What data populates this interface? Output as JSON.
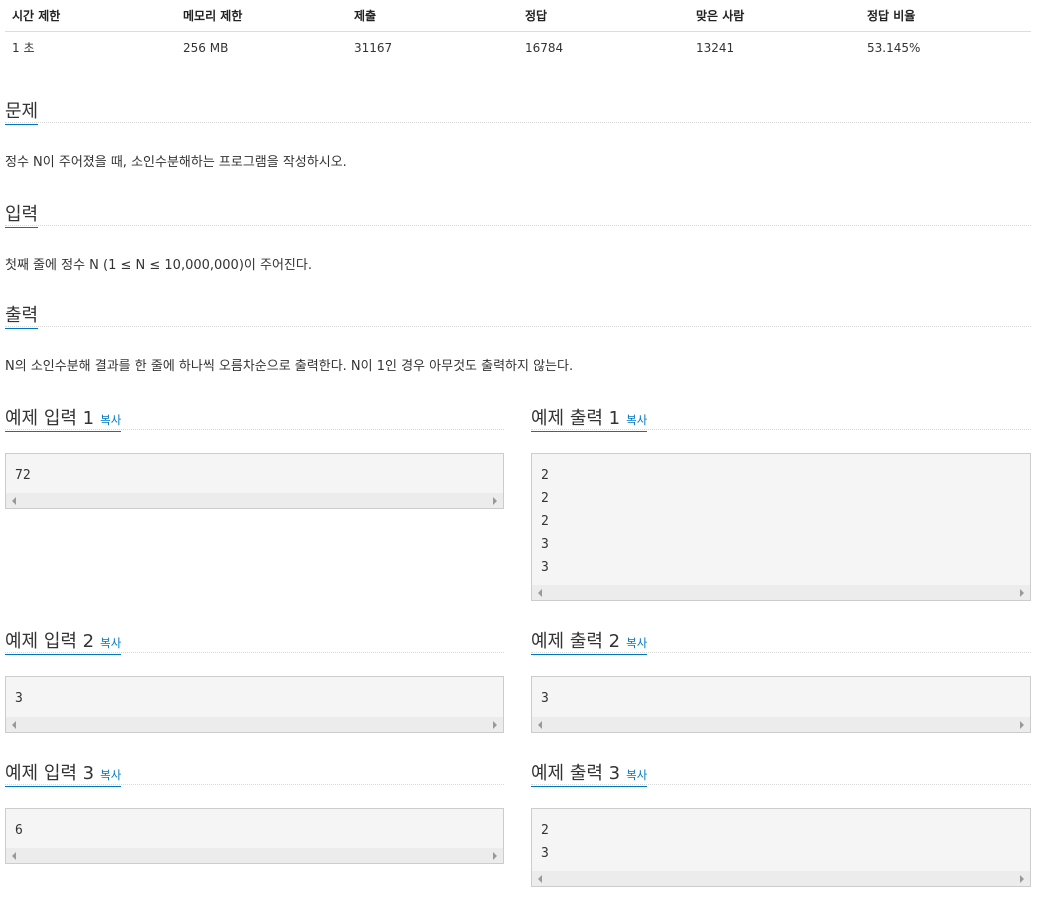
{
  "info_table": {
    "headers": [
      "시간 제한",
      "메모리 제한",
      "제출",
      "정답",
      "맞은 사람",
      "정답 비율"
    ],
    "values": [
      "1 초",
      "256 MB",
      "31167",
      "16784",
      "13241",
      "53.145%"
    ]
  },
  "problem": {
    "title": "문제",
    "text": "정수 N이 주어졌을 때, 소인수분해하는 프로그램을 작성하시오."
  },
  "input": {
    "title": "입력",
    "text": "첫째 줄에 정수 N (1 ≤ N ≤ 10,000,000)이 주어진다."
  },
  "output": {
    "title": "출력",
    "text": "N의 소인수분해 결과를 한 줄에 하나씩 오름차순으로 출력한다. N이 1인 경우 아무것도 출력하지 않는다."
  },
  "copy_label": "복사",
  "samples": [
    {
      "input_title": "예제 입력 1",
      "input_lines": [
        "72"
      ],
      "output_title": "예제 출력 1",
      "output_lines": [
        "2",
        "2",
        "2",
        "3",
        "3"
      ]
    },
    {
      "input_title": "예제 입력 2",
      "input_lines": [
        "3"
      ],
      "output_title": "예제 출력 2",
      "output_lines": [
        "3"
      ]
    },
    {
      "input_title": "예제 입력 3",
      "input_lines": [
        "6"
      ],
      "output_title": "예제 출력 3",
      "output_lines": [
        "2",
        "3"
      ]
    }
  ]
}
